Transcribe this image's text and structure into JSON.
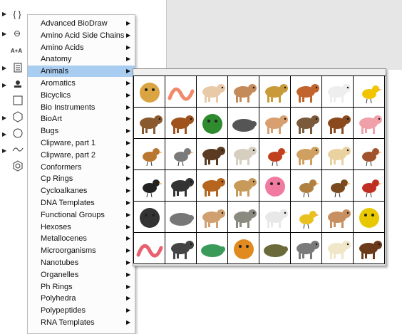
{
  "menu": {
    "selected": "Animals",
    "items": [
      "Advanced BioDraw",
      "Amino Acid Side Chains",
      "Amino Acids",
      "Anatomy",
      "Animals",
      "Aromatics",
      "Bicyclics",
      "Bio Instruments",
      "BioArt",
      "Bugs",
      "Clipware, part 1",
      "Clipware, part 2",
      "Conformers",
      "Cp Rings",
      "Cycloalkanes",
      "DNA Templates",
      "Functional Groups",
      "Hexoses",
      "Metallocenes",
      "Microorganisms",
      "Nanotubes",
      "Organelles",
      "Ph Rings",
      "Polyhedra",
      "Polypeptides",
      "RNA Templates"
    ]
  },
  "toolbar": {
    "braces_label": "{ }",
    "minus_circle_label": "⊖",
    "font_size_label": "A+A"
  },
  "gallery": {
    "animals": [
      {
        "name": "guinea-pig",
        "color": "#d9a441"
      },
      {
        "name": "worm",
        "color": "#f08a6a"
      },
      {
        "name": "rat",
        "color": "#e8c9a8"
      },
      {
        "name": "rabbit",
        "color": "#c48a5a"
      },
      {
        "name": "monkey",
        "color": "#c89a3a"
      },
      {
        "name": "weasel",
        "color": "#c2642e"
      },
      {
        "name": "mouse",
        "color": "#eeeeee"
      },
      {
        "name": "yellow-bird",
        "color": "#f2c400"
      },
      {
        "name": "bear-cub",
        "color": "#8a5a2e"
      },
      {
        "name": "fox",
        "color": "#a0521d"
      },
      {
        "name": "frog",
        "color": "#2e8b2e"
      },
      {
        "name": "bat",
        "color": "#555555"
      },
      {
        "name": "dog",
        "color": "#d8a070"
      },
      {
        "name": "grizzly-bear",
        "color": "#7a5a3a"
      },
      {
        "name": "horse",
        "color": "#8b4a1e"
      },
      {
        "name": "pig",
        "color": "#f0a0a8"
      },
      {
        "name": "owl",
        "color": "#b8762e"
      },
      {
        "name": "pigeon",
        "color": "#7a7a7a"
      },
      {
        "name": "bison",
        "color": "#5a3a20"
      },
      {
        "name": "sheep",
        "color": "#d6cfc0"
      },
      {
        "name": "turkey",
        "color": "#c04020"
      },
      {
        "name": "camel",
        "color": "#d0a060"
      },
      {
        "name": "cat",
        "color": "#ead2a0"
      },
      {
        "name": "hen",
        "color": "#a0522d"
      },
      {
        "name": "magpie",
        "color": "#222222"
      },
      {
        "name": "black-cat",
        "color": "#333333"
      },
      {
        "name": "calf",
        "color": "#b5651d"
      },
      {
        "name": "greyhound",
        "color": "#c89a5a"
      },
      {
        "name": "sea-urchin",
        "color": "#f07aa0"
      },
      {
        "name": "duck",
        "color": "#b08040"
      },
      {
        "name": "eagle",
        "color": "#7a4a1e"
      },
      {
        "name": "rooster",
        "color": "#c03020"
      },
      {
        "name": "gorilla",
        "color": "#333333"
      },
      {
        "name": "badger",
        "color": "#777777"
      },
      {
        "name": "puppy",
        "color": "#d0a070"
      },
      {
        "name": "elephant",
        "color": "#8a8a80"
      },
      {
        "name": "dalmatian",
        "color": "#e8e8e8"
      },
      {
        "name": "bird-pair",
        "color": "#e8c020"
      },
      {
        "name": "kangaroo",
        "color": "#c89060"
      },
      {
        "name": "lion",
        "color": "#e8c800"
      },
      {
        "name": "snake",
        "color": "#e86070"
      },
      {
        "name": "zebra",
        "color": "#444444"
      },
      {
        "name": "turtle",
        "color": "#3a9a5a"
      },
      {
        "name": "tiger",
        "color": "#e08a20"
      },
      {
        "name": "tortoise",
        "color": "#6a6a3a"
      },
      {
        "name": "rhino",
        "color": "#7a7a7a"
      },
      {
        "name": "polar-bear",
        "color": "#f0e6c8"
      },
      {
        "name": "moose",
        "color": "#6a3a1a"
      }
    ]
  }
}
